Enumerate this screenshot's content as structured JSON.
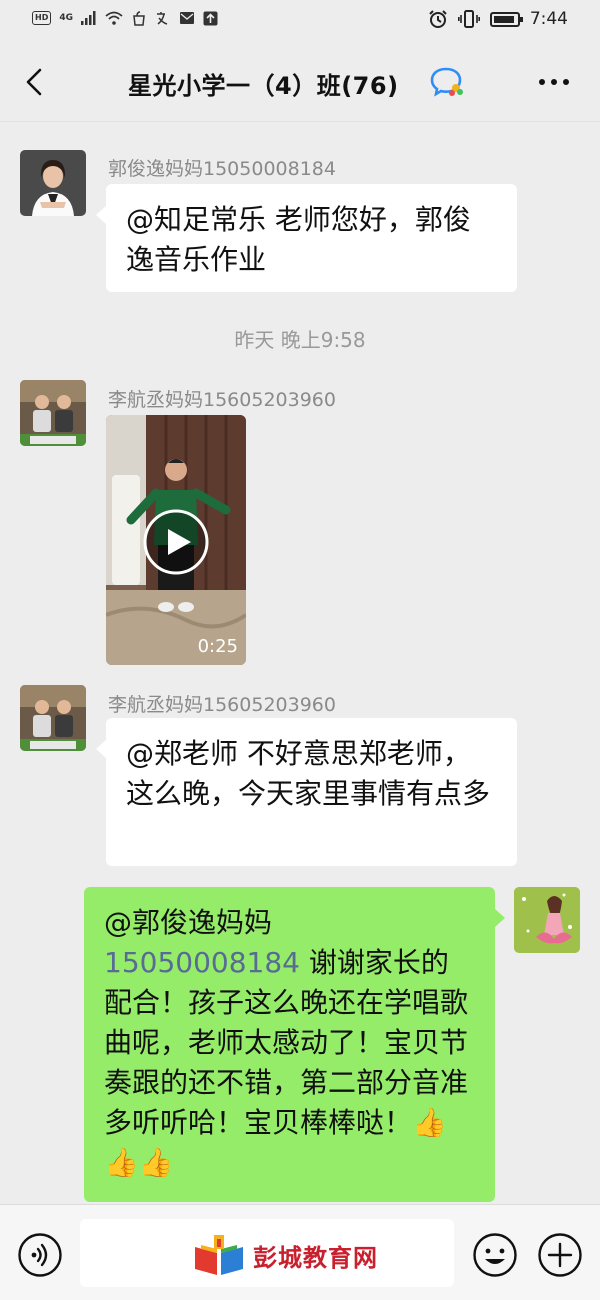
{
  "status_bar": {
    "hd_label": "HD",
    "network_label": "4G",
    "time": "7:44"
  },
  "header": {
    "title": "星光小学一（4）班(76)",
    "back_icon": "back-arrow-icon",
    "more_icon": "more-icon",
    "group_badge_icon": "group-chat-icon"
  },
  "messages": [
    {
      "sender": "郭俊逸妈妈15050008184",
      "type": "text",
      "text": "@知足常乐  老师您好，郭俊逸音乐作业"
    },
    {
      "type": "timestamp",
      "text": "昨天 晚上9:58"
    },
    {
      "sender": "李航丞妈妈15605203960",
      "type": "video",
      "duration": "0:25"
    },
    {
      "sender": "李航丞妈妈15605203960",
      "type": "text",
      "text": "@郑老师  不好意思郑老师，这么晚，今天家里事情有点多"
    },
    {
      "sender": "me",
      "type": "text",
      "mention": "@郭俊逸妈妈",
      "phone": "15050008184",
      "text": "谢谢家长的配合！孩子这么晚还在学唱歌曲呢，老师太感动了！宝贝节奏跟的还不错，第二部分音准多听听哈！宝贝棒棒哒！",
      "emoji": "👍👍👍"
    }
  ],
  "input_bar": {
    "voice_icon": "voice-icon",
    "emoji_icon": "emoji-icon",
    "plus_icon": "plus-icon",
    "watermark_text": "彭城教育网"
  },
  "colors": {
    "background": "#ededed",
    "bubble_mine": "#95ec69",
    "bubble_other": "#ffffff",
    "link": "#576b95"
  }
}
